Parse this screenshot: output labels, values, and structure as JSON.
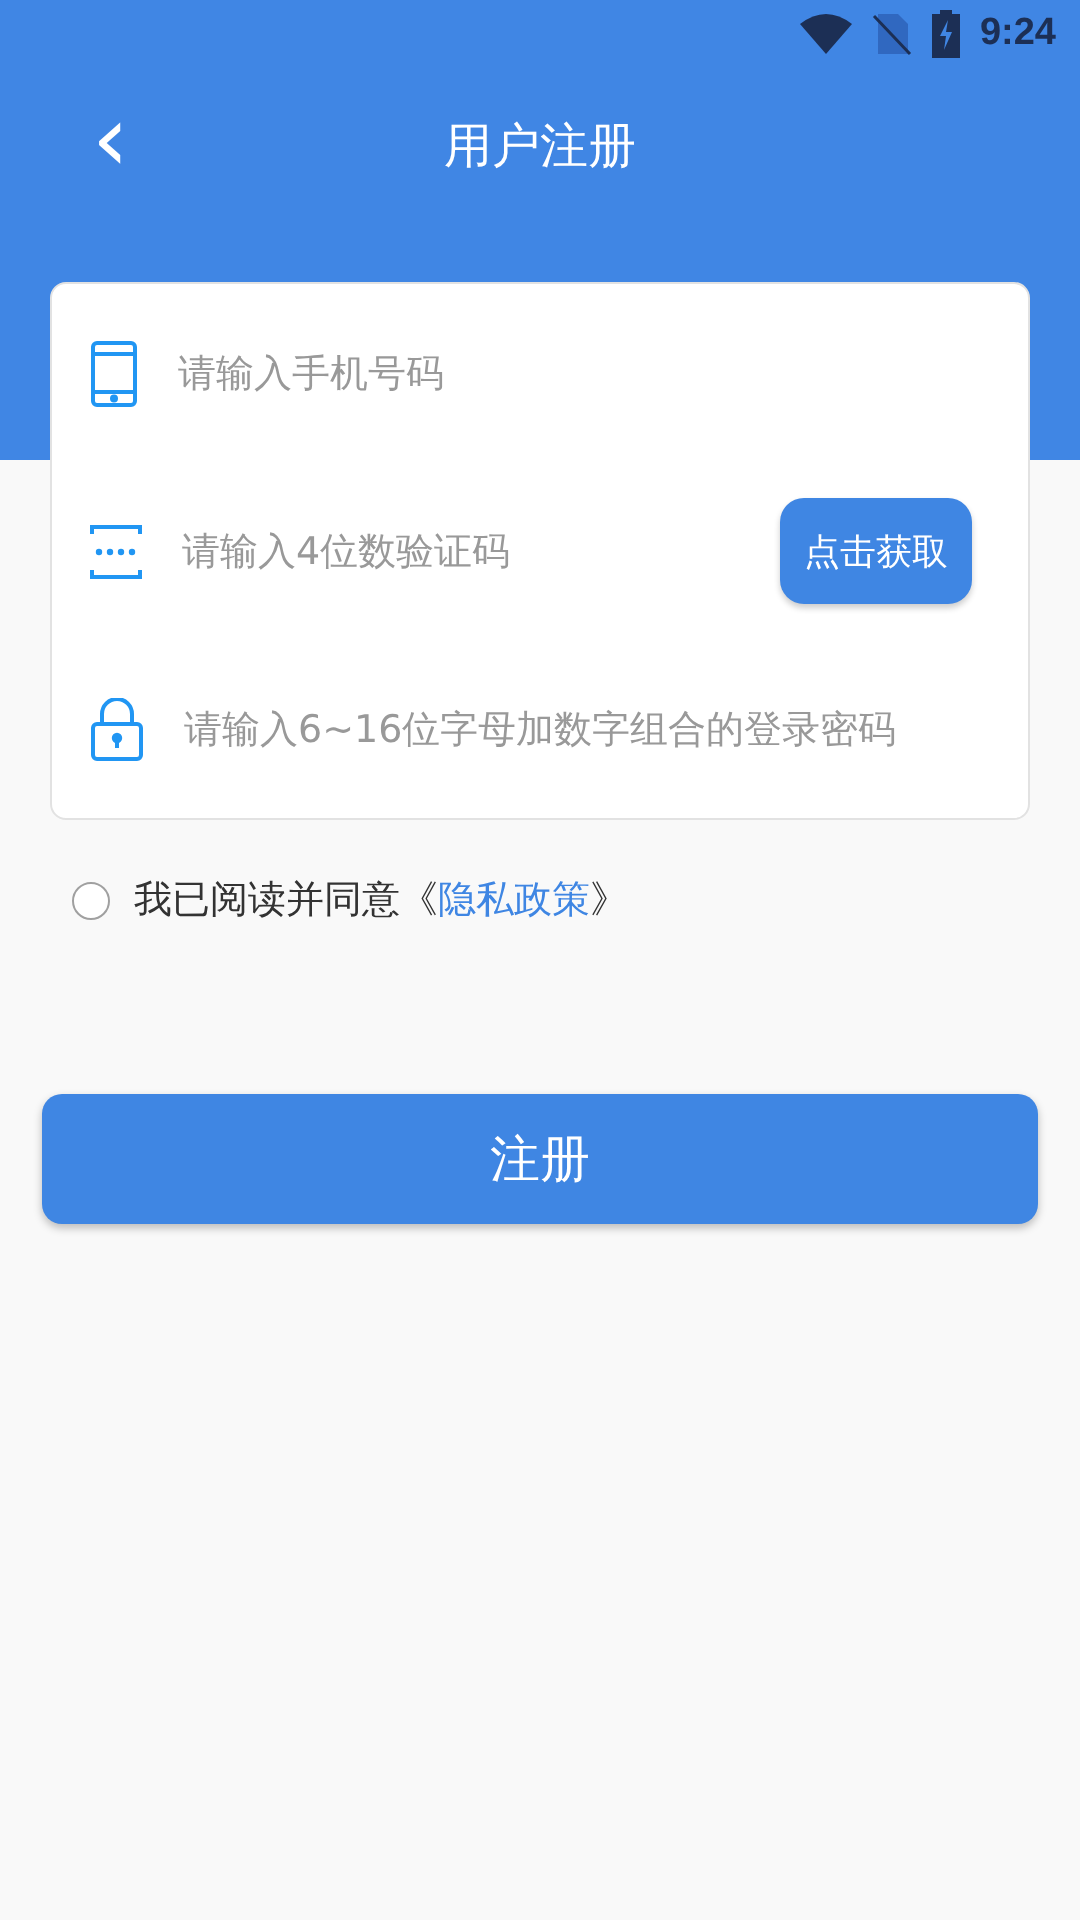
{
  "status_bar": {
    "time": "9:24"
  },
  "header": {
    "back": "‹",
    "title": "用户注册"
  },
  "fields": [
    {
      "kind": "phone",
      "placeholder": "请输入手机号码"
    },
    {
      "kind": "code",
      "placeholder": "请输入4位数验证码",
      "action": "点击获取"
    },
    {
      "kind": "password",
      "placeholder": "请输入6~16位字母加数字组合的登录密码"
    }
  ],
  "agreement": {
    "checked": false,
    "prefix": "我已阅读并同意《",
    "link": "隐私政策",
    "suffix": "》"
  },
  "submit": "注册"
}
